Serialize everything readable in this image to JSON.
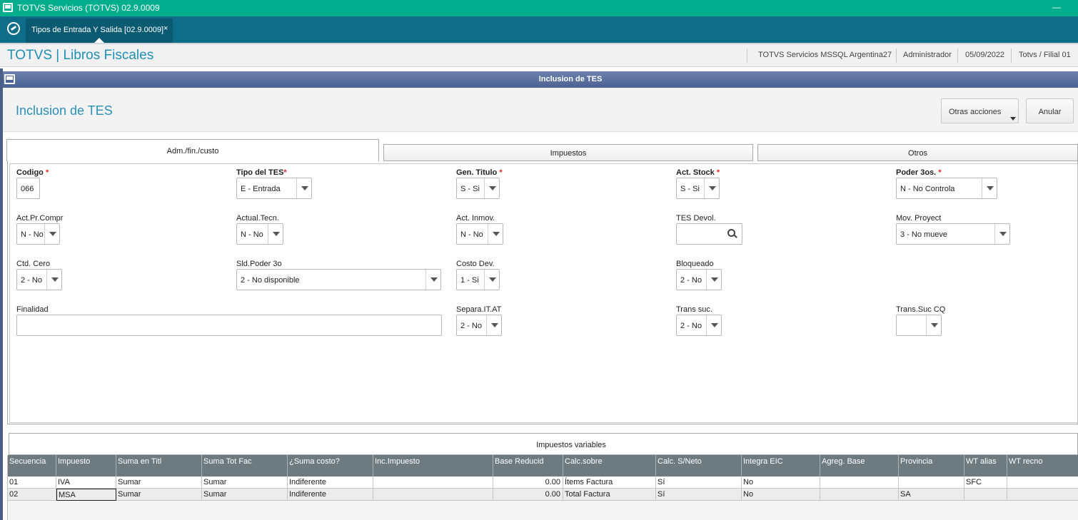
{
  "window": {
    "title": "TOTVS Servicios (TOTVS) 02.9.0009",
    "minimize": "—"
  },
  "tabbar": {
    "tab_label": "Tipos de Entrada Y Salida [02.9.0009]",
    "tab_close": "×"
  },
  "header": {
    "brand": "TOTVS | Libros Fiscales",
    "environment": "TOTVS Servicios MSSQL Argentina27",
    "user": "Administrador",
    "date": "05/09/2022",
    "branch": "Totvs / Filial 01"
  },
  "dialog": {
    "title": "Inclusion de TES"
  },
  "form": {
    "title": "Inclusion de TES",
    "buttons": {
      "otras": "Otras acciones",
      "anular": "Anular"
    },
    "tabs": [
      "Adm./fin./custo",
      "Impuestos",
      "Otros"
    ],
    "fields": {
      "codigo": {
        "label": "Codigo",
        "value": "066",
        "required": "*"
      },
      "tipo_tes": {
        "label": "Tipo del TES",
        "value": "E - Entrada",
        "required": "*"
      },
      "gen_titulo": {
        "label": "Gen. Titulo",
        "value": "S - Si",
        "required": "*"
      },
      "act_stock": {
        "label": "Act. Stock",
        "value": "S - Si",
        "required": "*"
      },
      "poder_3os": {
        "label": "Poder 3os.",
        "value": "N - No Controla",
        "required": "*"
      },
      "act_pr_compr": {
        "label": "Act.Pr.Compr",
        "value": "N - No"
      },
      "actual_tecn": {
        "label": "Actual.Tecn.",
        "value": "N - No"
      },
      "act_inmov": {
        "label": "Act. Inmov.",
        "value": "N - No"
      },
      "tes_devol": {
        "label": "TES Devol.",
        "value": ""
      },
      "mov_proyect": {
        "label": "Mov. Proyect",
        "value": "3 - No mueve"
      },
      "ctd_cero": {
        "label": "Ctd. Cero",
        "value": "2 - No"
      },
      "sld_poder_3o": {
        "label": "Sld.Poder 3o",
        "value": "2 - No disponible"
      },
      "costo_dev": {
        "label": "Costo Dev.",
        "value": "1 - Si"
      },
      "bloqueado": {
        "label": "Bloqueado",
        "value": "2 - No"
      },
      "finalidad": {
        "label": "Finalidad",
        "value": ""
      },
      "separa_it_at": {
        "label": "Separa.IT.AT",
        "value": "2 - No"
      },
      "trans_suc": {
        "label": "Trans suc.",
        "value": "2 - No"
      },
      "trans_suc_cq": {
        "label": "Trans.Suc CQ",
        "value": ""
      }
    }
  },
  "impuestos": {
    "title": "Impuestos variables",
    "columns": [
      "Secuencia",
      "Impuesto",
      "Suma en Titl",
      "Suma Tot Fac",
      "¿Suma costo?",
      "Inc.Impuesto",
      "Base Reducid",
      "Calc.sobre",
      "Calc. S/Neto",
      "Integra EIC",
      "Agreg. Base",
      "Provincia",
      "WT alias",
      "WT recno"
    ],
    "rows": [
      [
        "01",
        "IVA",
        "Sumar",
        "Sumar",
        "Indiferente",
        "",
        "0.00",
        "Ítems Factura",
        "Sí",
        "No",
        "",
        "",
        "SFC",
        ""
      ],
      [
        "02",
        "MSA",
        "Sumar",
        "Sumar",
        "Indiferente",
        "",
        "0.00",
        "Total Factura",
        "Sí",
        "No",
        "",
        "SA",
        "",
        ""
      ]
    ]
  }
}
